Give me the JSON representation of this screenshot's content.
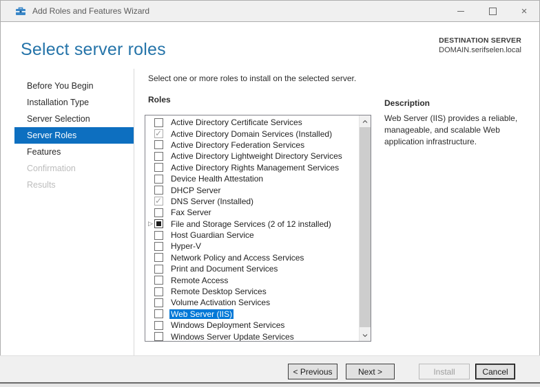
{
  "window": {
    "title": "Add Roles and Features Wizard",
    "icons": {
      "minimize": "minimize",
      "maximize": "maximize",
      "close": "×"
    }
  },
  "header": {
    "title": "Select server roles",
    "destination_label": "DESTINATION SERVER",
    "destination_value": "DOMAIN.serifselen.local"
  },
  "sidebar": {
    "items": [
      {
        "label": "Before You Begin",
        "state": "enabled"
      },
      {
        "label": "Installation Type",
        "state": "enabled"
      },
      {
        "label": "Server Selection",
        "state": "enabled"
      },
      {
        "label": "Server Roles",
        "state": "selected"
      },
      {
        "label": "Features",
        "state": "enabled"
      },
      {
        "label": "Confirmation",
        "state": "disabled"
      },
      {
        "label": "Results",
        "state": "disabled"
      }
    ]
  },
  "main": {
    "instruction": "Select one or more roles to install on the selected server.",
    "roles_label": "Roles",
    "roles": [
      {
        "label": "Active Directory Certificate Services",
        "checkbox": "unchecked",
        "selected": false,
        "expandable": false
      },
      {
        "label": "Active Directory Domain Services (Installed)",
        "checkbox": "checked",
        "selected": false,
        "expandable": false
      },
      {
        "label": "Active Directory Federation Services",
        "checkbox": "unchecked",
        "selected": false,
        "expandable": false
      },
      {
        "label": "Active Directory Lightweight Directory Services",
        "checkbox": "unchecked",
        "selected": false,
        "expandable": false
      },
      {
        "label": "Active Directory Rights Management Services",
        "checkbox": "unchecked",
        "selected": false,
        "expandable": false
      },
      {
        "label": "Device Health Attestation",
        "checkbox": "unchecked",
        "selected": false,
        "expandable": false
      },
      {
        "label": "DHCP Server",
        "checkbox": "unchecked",
        "selected": false,
        "expandable": false
      },
      {
        "label": "DNS Server (Installed)",
        "checkbox": "checked",
        "selected": false,
        "expandable": false
      },
      {
        "label": "Fax Server",
        "checkbox": "unchecked",
        "selected": false,
        "expandable": false
      },
      {
        "label": "File and Storage Services (2 of 12 installed)",
        "checkbox": "indeterminate",
        "selected": false,
        "expandable": true
      },
      {
        "label": "Host Guardian Service",
        "checkbox": "unchecked",
        "selected": false,
        "expandable": false
      },
      {
        "label": "Hyper-V",
        "checkbox": "unchecked",
        "selected": false,
        "expandable": false
      },
      {
        "label": "Network Policy and Access Services",
        "checkbox": "unchecked",
        "selected": false,
        "expandable": false
      },
      {
        "label": "Print and Document Services",
        "checkbox": "unchecked",
        "selected": false,
        "expandable": false
      },
      {
        "label": "Remote Access",
        "checkbox": "unchecked",
        "selected": false,
        "expandable": false
      },
      {
        "label": "Remote Desktop Services",
        "checkbox": "unchecked",
        "selected": false,
        "expandable": false
      },
      {
        "label": "Volume Activation Services",
        "checkbox": "unchecked",
        "selected": false,
        "expandable": false
      },
      {
        "label": "Web Server (IIS)",
        "checkbox": "unchecked",
        "selected": true,
        "expandable": false
      },
      {
        "label": "Windows Deployment Services",
        "checkbox": "unchecked",
        "selected": false,
        "expandable": false
      },
      {
        "label": "Windows Server Update Services",
        "checkbox": "unchecked",
        "selected": false,
        "expandable": false
      }
    ]
  },
  "description": {
    "heading": "Description",
    "text": "Web Server (IIS) provides a reliable, manageable, and scalable Web application infrastructure."
  },
  "footer": {
    "previous_label": "< Previous",
    "next_label": "Next >",
    "install_label": "Install",
    "cancel_label": "Cancel"
  },
  "colors": {
    "accent_blue": "#0d6fc0",
    "selection_blue": "#0078d7",
    "title_blue": "#2574a9",
    "titlebar_bg": "#f0f0f0",
    "footer_bg": "#f0f0f0"
  }
}
